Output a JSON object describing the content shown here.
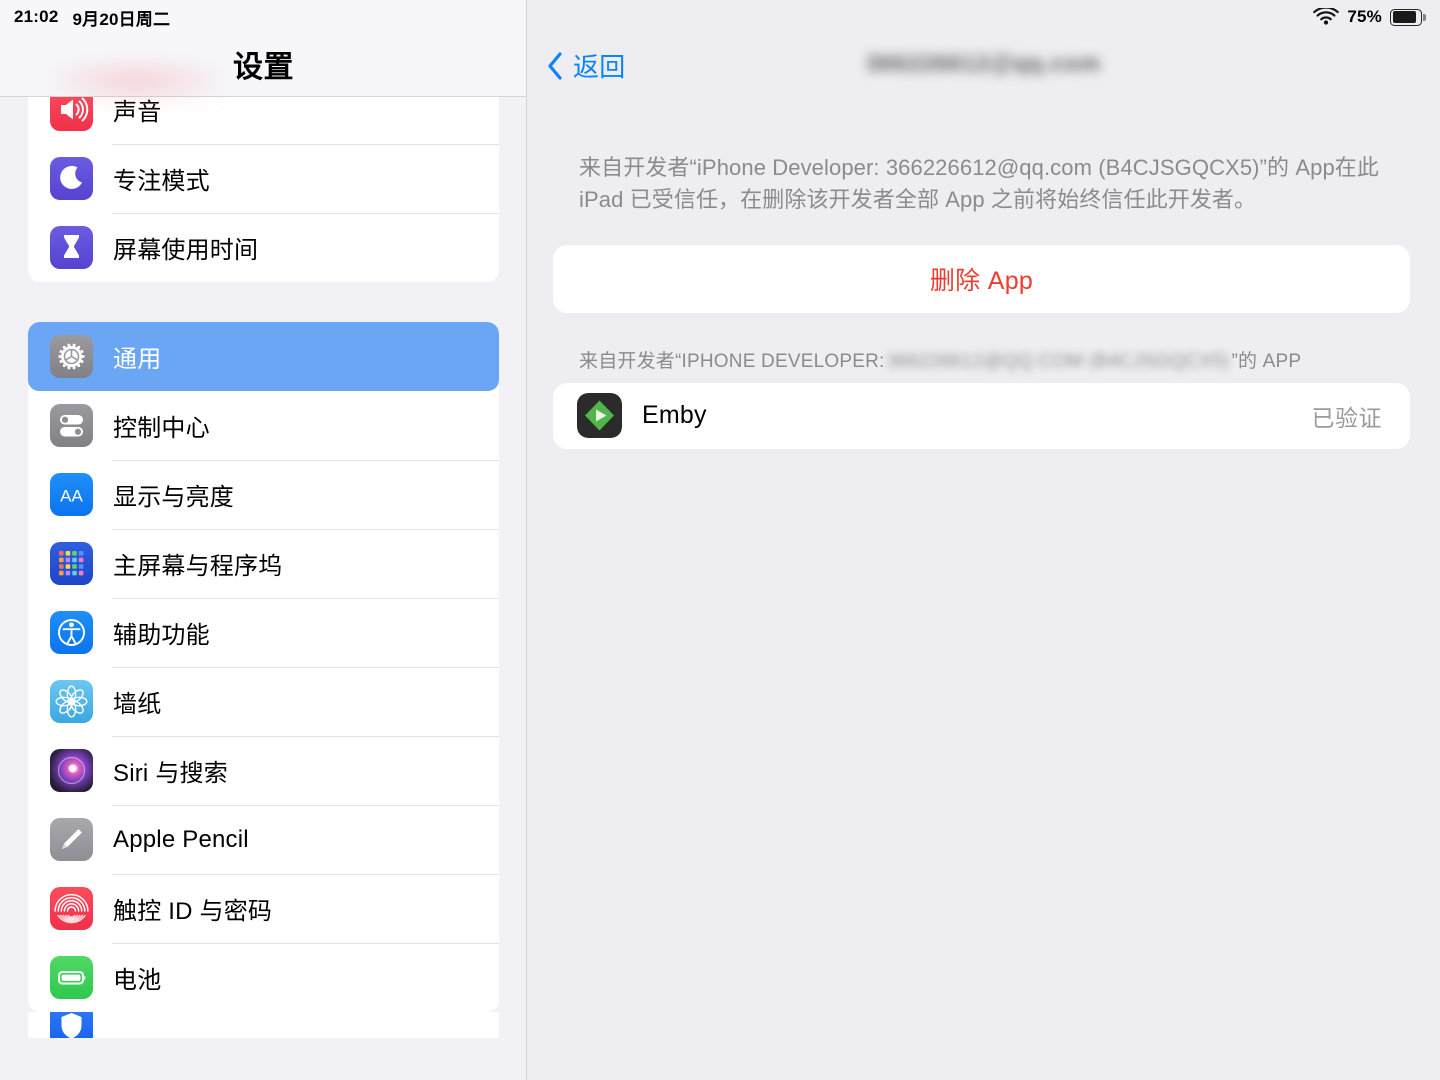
{
  "status_bar": {
    "time": "21:02",
    "date": "9月20日周二",
    "wifi_icon": "wifi-icon",
    "battery_percent": "75%",
    "battery_icon": "battery-icon",
    "battery_level": 75
  },
  "sidebar": {
    "title": "设置",
    "groups": [
      {
        "id": "group-top",
        "items": [
          {
            "label": "声音",
            "icon": "speaker-icon",
            "icon_class": "ic-sound",
            "selected": false
          },
          {
            "label": "专注模式",
            "icon": "moon-icon",
            "icon_class": "ic-focus",
            "selected": false
          },
          {
            "label": "屏幕使用时间",
            "icon": "hourglass-icon",
            "icon_class": "ic-screentime",
            "selected": false
          }
        ]
      },
      {
        "id": "group-second",
        "items": [
          {
            "label": "通用",
            "icon": "gear-icon",
            "icon_class": "ic-general",
            "selected": true
          },
          {
            "label": "控制中心",
            "icon": "toggles-icon",
            "icon_class": "ic-control",
            "selected": false
          },
          {
            "label": "显示与亮度",
            "icon": "aa-text-icon",
            "icon_class": "ic-display",
            "selected": false
          },
          {
            "label": "主屏幕与程序坞",
            "icon": "app-grid-icon",
            "icon_class": "ic-home",
            "selected": false
          },
          {
            "label": "辅助功能",
            "icon": "accessibility-icon",
            "icon_class": "ic-access",
            "selected": false
          },
          {
            "label": "墙纸",
            "icon": "flower-icon",
            "icon_class": "ic-wallpaper",
            "selected": false
          },
          {
            "label": "Siri 与搜索",
            "icon": "siri-orb-icon",
            "icon_class": "ic-siri",
            "selected": false
          },
          {
            "label": "Apple Pencil",
            "icon": "pencil-icon",
            "icon_class": "ic-pencil",
            "selected": false
          },
          {
            "label": "触控 ID 与密码",
            "icon": "fingerprint-icon",
            "icon_class": "ic-touchid",
            "selected": false
          },
          {
            "label": "电池",
            "icon": "battery-icon",
            "icon_class": "ic-battery",
            "selected": false
          }
        ]
      }
    ]
  },
  "main": {
    "back_label": "返回",
    "back_icon": "chevron-left-icon",
    "nav_title": "366226612@qq.com",
    "description": "来自开发者“iPhone Developer: 366226612@qq.com (B4CJSGQCX5)”的 App在此iPad 已受信任，在删除该开发者全部 App 之前将始终信任此开发者。",
    "delete_button_label": "删除 App",
    "delete_button_color": "#EF3B30",
    "section_header": {
      "prefix": "来自开发者“IPHONE DEVELOPER:",
      "redacted": "366226612@QQ.COM (B4CJSGQCX5)",
      "suffix": "”的 APP"
    },
    "apps": [
      {
        "name": "Emby",
        "status": "已验证",
        "icon": "emby-app-icon",
        "icon_bg": "#2B2B2B",
        "icon_accent": "#52B54B"
      }
    ]
  }
}
